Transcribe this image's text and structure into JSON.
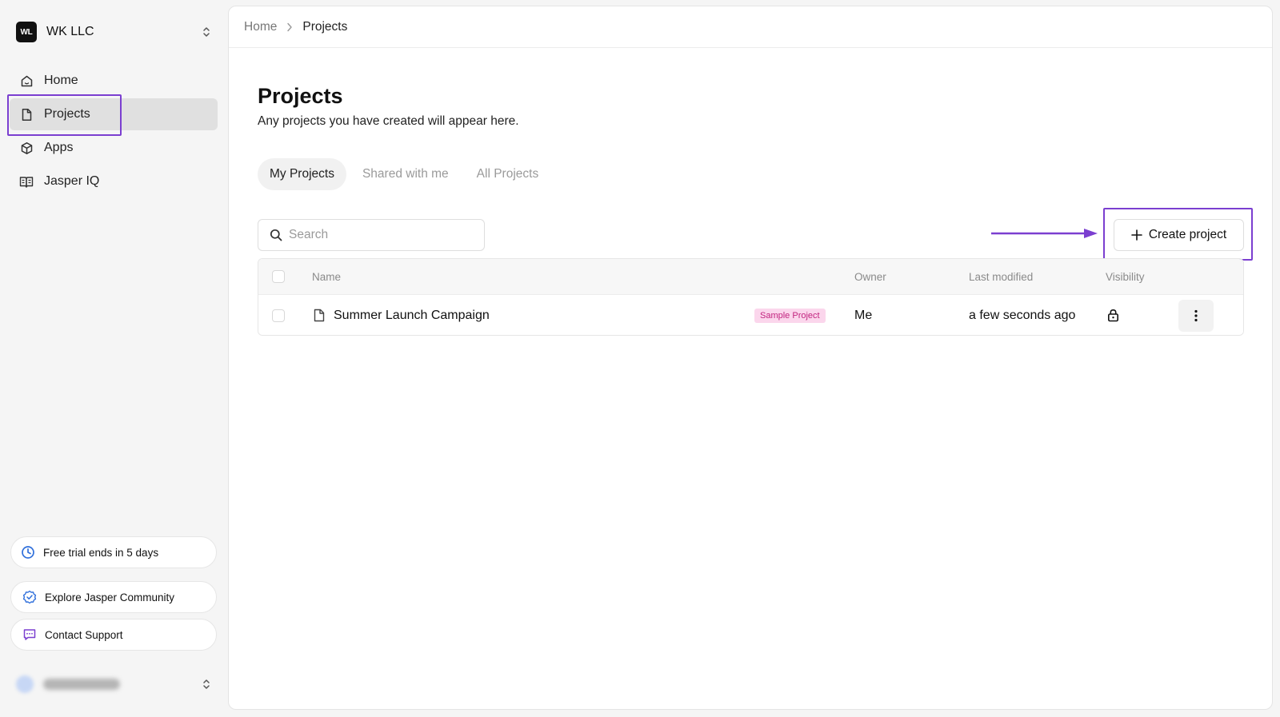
{
  "workspace": {
    "logo_text": "WL",
    "name": "WK LLC"
  },
  "sidebar": {
    "items": [
      {
        "label": "Home",
        "icon": "home-icon"
      },
      {
        "label": "Projects",
        "icon": "document-icon",
        "active": true
      },
      {
        "label": "Apps",
        "icon": "cube-icon"
      },
      {
        "label": "Jasper IQ",
        "icon": "book-icon"
      }
    ],
    "trial": "Free trial ends in 5 days",
    "community": "Explore Jasper Community",
    "support": "Contact Support"
  },
  "breadcrumb": {
    "home": "Home",
    "current": "Projects"
  },
  "page": {
    "title": "Projects",
    "subtitle": "Any projects you have created will appear here."
  },
  "tabs": [
    {
      "label": "My Projects",
      "active": true
    },
    {
      "label": "Shared with me"
    },
    {
      "label": "All Projects"
    }
  ],
  "search": {
    "placeholder": "Search",
    "value": ""
  },
  "create_button": {
    "label": "Create project"
  },
  "table": {
    "headers": {
      "name": "Name",
      "owner": "Owner",
      "last_modified": "Last modified",
      "visibility": "Visibility"
    },
    "rows": [
      {
        "name": "Summer Launch Campaign",
        "badge": "Sample Project",
        "owner": "Me",
        "last_modified": "a few seconds ago",
        "visibility": "lock-icon"
      }
    ]
  },
  "colors": {
    "highlight": "#7b3fd0",
    "active_nav": "#e0e0e0",
    "badge_bg": "#fbd6ec",
    "badge_text": "#c2247f",
    "trial_icon": "#2f6fdb"
  }
}
